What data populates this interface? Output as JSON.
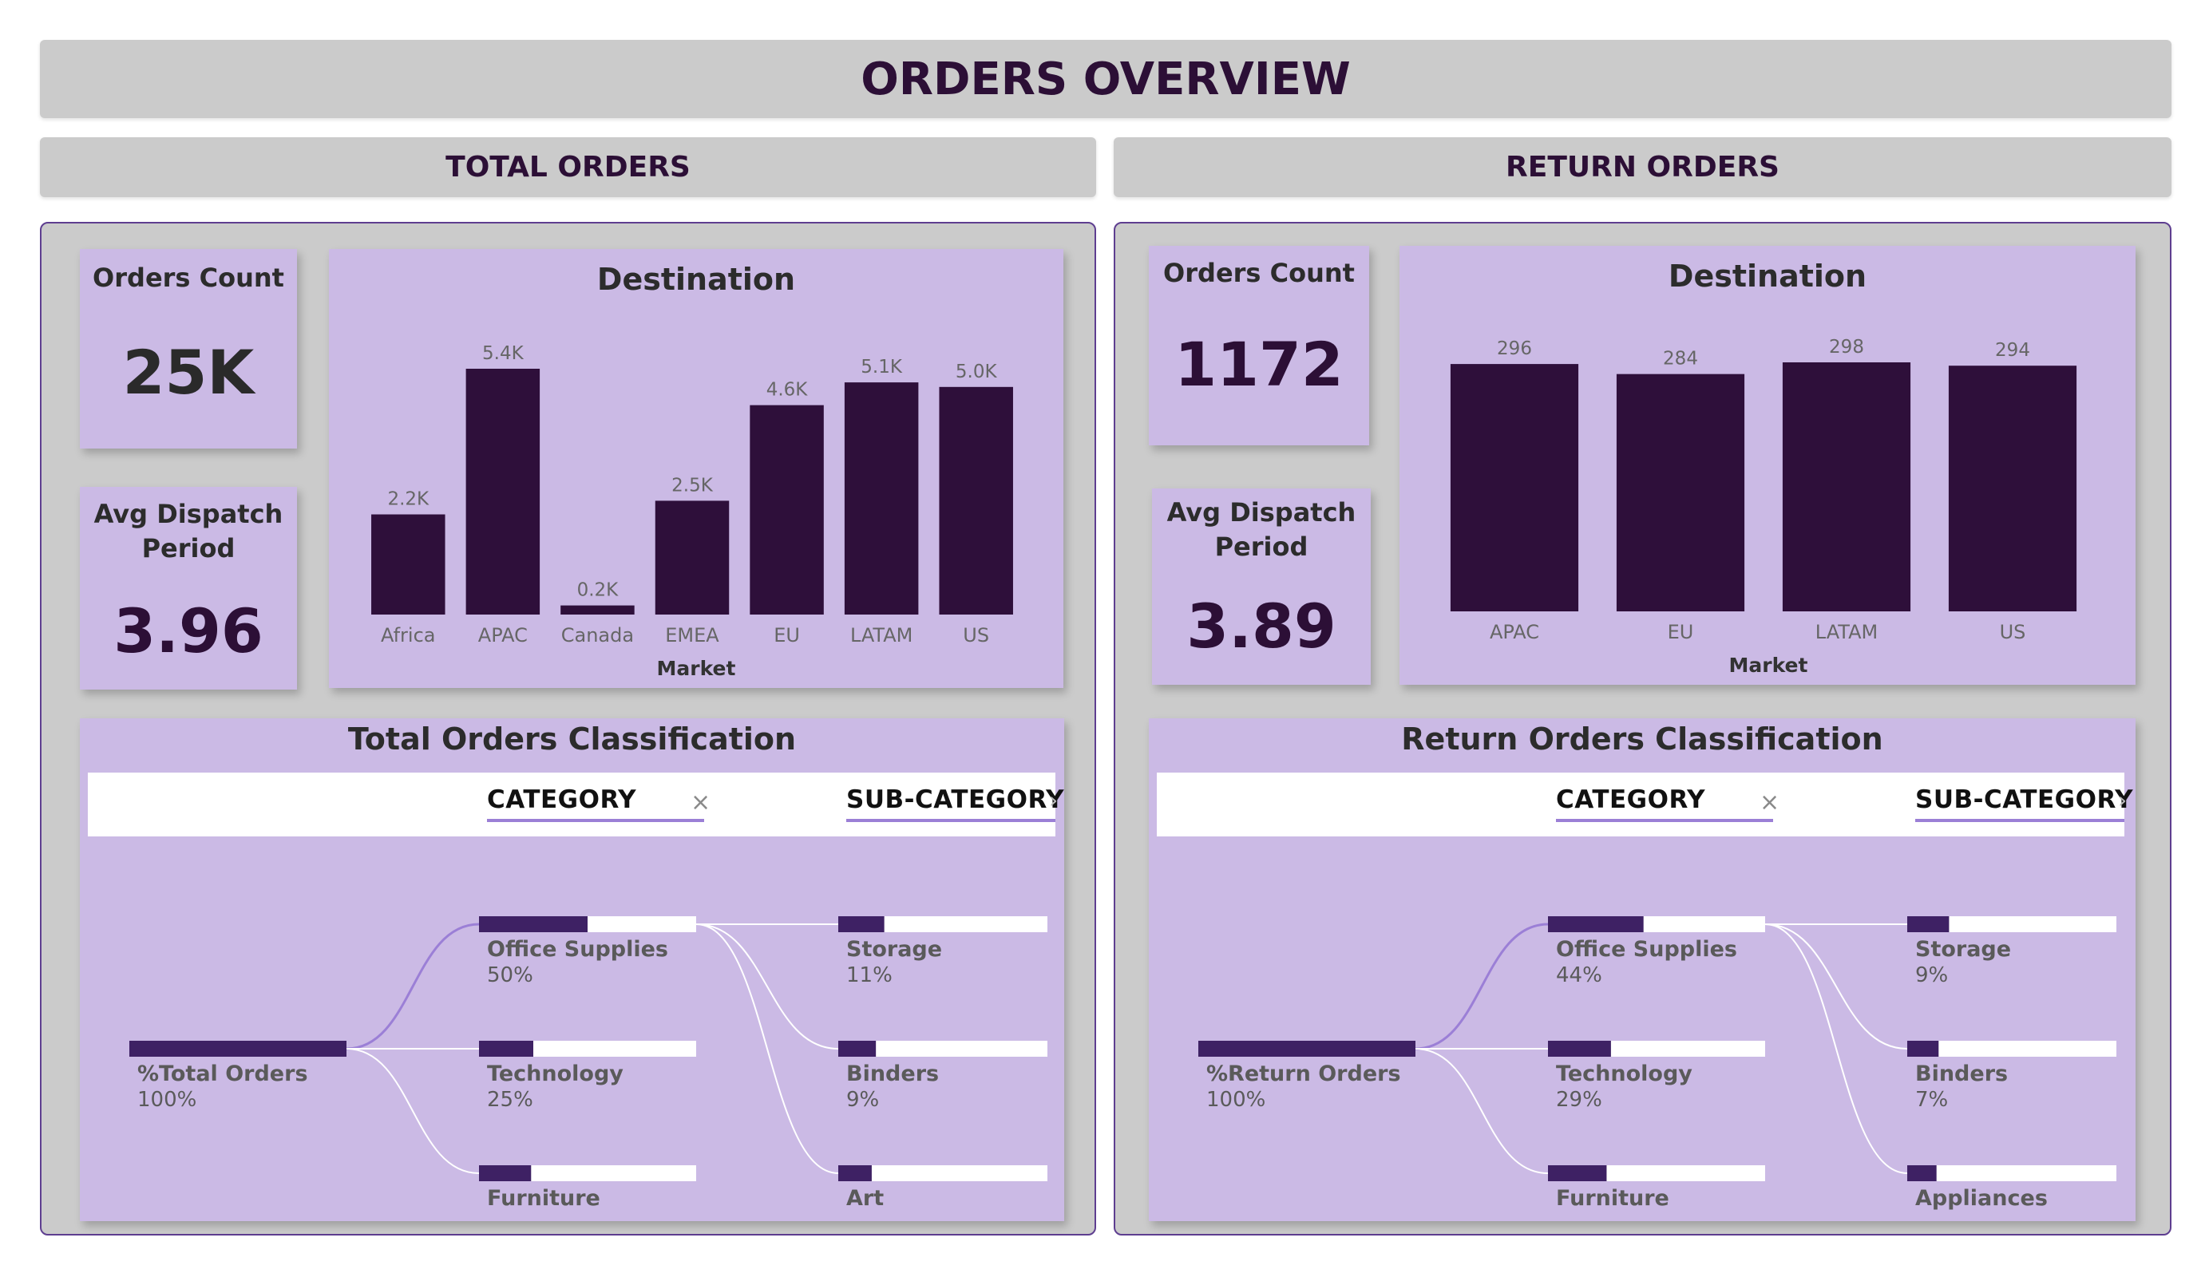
{
  "page_title": "ORDERS OVERVIEW",
  "colors": {
    "bar": "#2e0f3a",
    "card": "#cbbae5",
    "banner": "#cbcbcb",
    "accent": "#9b7fd6"
  },
  "total": {
    "section_title": "TOTAL ORDERS",
    "orders_count": {
      "label": "Orders Count",
      "value": "25K"
    },
    "avg_dispatch": {
      "label_line1": "Avg Dispatch",
      "label_line2": "Period",
      "value": "3.96"
    },
    "destination": {
      "title": "Destination",
      "xlabel": "Market",
      "categories": [
        "Africa",
        "APAC",
        "Canada",
        "EMEA",
        "EU",
        "LATAM",
        "US"
      ],
      "values": [
        2.2,
        5.4,
        0.2,
        2.5,
        4.6,
        5.1,
        5.0
      ],
      "value_labels": [
        "2.2K",
        "5.4K",
        "0.2K",
        "2.5K",
        "4.6K",
        "5.1K",
        "5.0K"
      ]
    },
    "classification": {
      "title": "Total Orders Classification",
      "col1": "CATEGORY",
      "col2": "SUB-CATEGORY",
      "close_icon": "×",
      "more_icon": "›",
      "root": {
        "label": "%Total Orders",
        "pct": "100%",
        "fill": 1.0
      },
      "level1": [
        {
          "label": "Office Supplies",
          "pct": "50%",
          "fill": 0.5,
          "expanded": true
        },
        {
          "label": "Technology",
          "pct": "25%",
          "fill": 0.25
        },
        {
          "label": "Furniture",
          "pct": "",
          "fill": 0.24
        }
      ],
      "level2": [
        {
          "label": "Storage",
          "pct": "11%",
          "fill": 0.22
        },
        {
          "label": "Binders",
          "pct": "9%",
          "fill": 0.18
        },
        {
          "label": "Art",
          "pct": "",
          "fill": 0.16
        }
      ]
    }
  },
  "returns": {
    "section_title": "RETURN ORDERS",
    "orders_count": {
      "label": "Orders Count",
      "value": "1172"
    },
    "avg_dispatch": {
      "label_line1": "Avg Dispatch",
      "label_line2": "Period",
      "value": "3.89"
    },
    "destination": {
      "title": "Destination",
      "xlabel": "Market",
      "categories": [
        "APAC",
        "EU",
        "LATAM",
        "US"
      ],
      "values": [
        296,
        284,
        298,
        294
      ],
      "value_labels": [
        "296",
        "284",
        "298",
        "294"
      ]
    },
    "classification": {
      "title": "Return Orders Classification",
      "col1": "CATEGORY",
      "col2": "SUB-CATEGORY",
      "close_icon": "×",
      "more_icon": "›",
      "root": {
        "label": "%Return Orders",
        "pct": "100%",
        "fill": 1.0
      },
      "level1": [
        {
          "label": "Office Supplies",
          "pct": "44%",
          "fill": 0.44,
          "expanded": true
        },
        {
          "label": "Technology",
          "pct": "29%",
          "fill": 0.29
        },
        {
          "label": "Furniture",
          "pct": "",
          "fill": 0.27
        }
      ],
      "level2": [
        {
          "label": "Storage",
          "pct": "9%",
          "fill": 0.2
        },
        {
          "label": "Binders",
          "pct": "7%",
          "fill": 0.15
        },
        {
          "label": "Appliances",
          "pct": "",
          "fill": 0.14
        }
      ]
    }
  },
  "chart_data": [
    {
      "type": "bar",
      "title": "Destination",
      "xlabel": "Market",
      "ylabel": "",
      "categories": [
        "Africa",
        "APAC",
        "Canada",
        "EMEA",
        "EU",
        "LATAM",
        "US"
      ],
      "values": [
        2200,
        5400,
        200,
        2500,
        4600,
        5100,
        5000
      ],
      "ylim": [
        0,
        5400
      ]
    },
    {
      "type": "bar",
      "title": "Destination",
      "xlabel": "Market",
      "ylabel": "",
      "categories": [
        "APAC",
        "EU",
        "LATAM",
        "US"
      ],
      "values": [
        296,
        284,
        298,
        294
      ],
      "ylim": [
        0,
        298
      ]
    }
  ]
}
